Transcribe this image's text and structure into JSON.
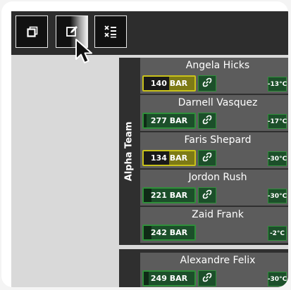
{
  "toolbar": {
    "buttons": [
      {
        "icon": "window-icon",
        "label": ""
      },
      {
        "icon": "edit-icon",
        "label": ""
      },
      {
        "icon": "clear-list-icon",
        "label": ""
      }
    ]
  },
  "teams": [
    {
      "name": "Alpha Team",
      "members": [
        {
          "name": "Angela Hicks",
          "pressure": "140 BAR",
          "pressure_level": 0.5,
          "status": "warning",
          "linked": true,
          "temp": "-13°C"
        },
        {
          "name": "Darnell Vasquez",
          "pressure": "277 BAR",
          "pressure_level": 0.05,
          "status": "ok",
          "linked": true,
          "temp": "-17°C"
        },
        {
          "name": "Faris Shepard",
          "pressure": "134 BAR",
          "pressure_level": 0.5,
          "status": "warning",
          "linked": true,
          "temp": "-30°C"
        },
        {
          "name": "Jordon Rush",
          "pressure": "221 BAR",
          "pressure_level": 0.15,
          "status": "ok",
          "linked": true,
          "temp": "-30°C"
        },
        {
          "name": "Zaid Frank",
          "pressure": "242 BAR",
          "pressure_level": 0.15,
          "status": "ok",
          "linked": false,
          "temp": "-2°C"
        }
      ]
    },
    {
      "name": "",
      "members": [
        {
          "name": "Alexandre Felix",
          "pressure": "249 BAR",
          "pressure_level": 0.1,
          "status": "ok",
          "linked": true,
          "temp": "-30°C"
        }
      ]
    }
  ],
  "colors": {
    "ok_border": "#2f8f3a",
    "warn_border": "#c9c21a",
    "card_bg": "#5c5c5c",
    "panel_bg": "#2f2f2f"
  }
}
